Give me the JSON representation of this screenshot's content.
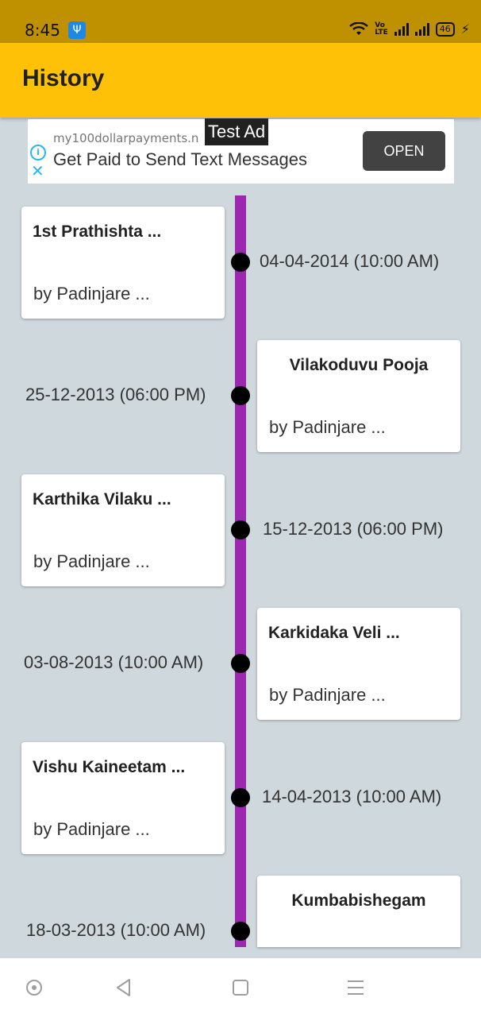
{
  "status_bar": {
    "time": "8:45",
    "battery": "46"
  },
  "app_bar": {
    "title": "History"
  },
  "ad": {
    "url": "my100dollarpayments.n",
    "headline": "Get Paid to Send Text Messages",
    "open_label": "OPEN",
    "tag": "Test Ad"
  },
  "timeline": {
    "items": [
      {
        "title": "1st Prathishta ...",
        "subtitle": "by Padinjare ...",
        "date": "04-04-2014 (10:00 AM)"
      },
      {
        "title": "Vilakoduvu Pooja",
        "subtitle": "by Padinjare ...",
        "date": "25-12-2013 (06:00 PM)"
      },
      {
        "title": "Karthika Vilaku ...",
        "subtitle": "by Padinjare ...",
        "date": "15-12-2013 (06:00 PM)"
      },
      {
        "title": "Karkidaka Veli ...",
        "subtitle": "by Padinjare ...",
        "date": "03-08-2013 (10:00 AM)"
      },
      {
        "title": "Vishu Kaineetam ...",
        "subtitle": "by Padinjare ...",
        "date": "14-04-2013 (10:00 AM)"
      },
      {
        "title": "Kumbabishegam",
        "subtitle": "",
        "date": "18-03-2013 (10:00 AM)"
      }
    ]
  },
  "colors": {
    "status_bar": "#bf9000",
    "app_bar": "#ffc107",
    "timeline_line": "#9c27b0",
    "background": "#cfd8dc"
  },
  "icons": {
    "nav": [
      "circle-icon",
      "back-icon",
      "home-square-icon",
      "menu-icon"
    ]
  }
}
